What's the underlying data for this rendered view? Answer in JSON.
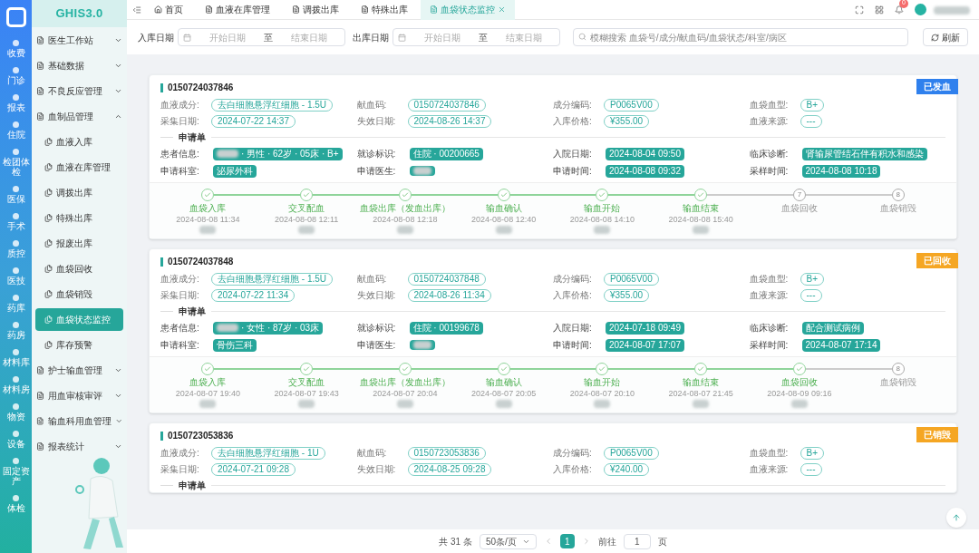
{
  "logo": "GHIS3.0",
  "rail": [
    {
      "label": "收费",
      "selected": false
    },
    {
      "label": "门诊",
      "selected": false
    },
    {
      "label": "报表",
      "selected": false
    },
    {
      "label": "住院",
      "selected": false
    },
    {
      "label": "检团体检",
      "selected": false
    },
    {
      "label": "医保",
      "selected": false
    },
    {
      "label": "手术",
      "selected": false
    },
    {
      "label": "质控",
      "selected": false
    },
    {
      "label": "医技",
      "selected": false
    },
    {
      "label": "药库",
      "selected": false
    },
    {
      "label": "药房",
      "selected": false
    },
    {
      "label": "材料库",
      "selected": false
    },
    {
      "label": "材料房",
      "selected": false
    },
    {
      "label": "物资",
      "selected": false
    },
    {
      "label": "设备",
      "selected": false
    },
    {
      "label": "固定资产",
      "selected": false
    },
    {
      "label": "体检",
      "selected": false
    }
  ],
  "menu": [
    {
      "label": "医生工作站",
      "expanded": false
    },
    {
      "label": "基础数据",
      "expanded": false
    },
    {
      "label": "不良反应管理",
      "expanded": false
    },
    {
      "label": "血制品管理",
      "expanded": true,
      "children": [
        {
          "label": "血液入库",
          "selected": false
        },
        {
          "label": "血液在库管理",
          "selected": false
        },
        {
          "label": "调拨出库",
          "selected": false
        },
        {
          "label": "特殊出库",
          "selected": false
        },
        {
          "label": "报废出库",
          "selected": false
        },
        {
          "label": "血袋回收",
          "selected": false
        },
        {
          "label": "血袋销毁",
          "selected": false
        },
        {
          "label": "血袋状态监控",
          "selected": true
        },
        {
          "label": "库存预警",
          "selected": false
        }
      ]
    },
    {
      "label": "护士输血管理",
      "expanded": false
    },
    {
      "label": "用血审核审评",
      "expanded": false
    },
    {
      "label": "输血科用血管理",
      "expanded": false
    },
    {
      "label": "报表统计",
      "expanded": false
    }
  ],
  "tabs": [
    {
      "label": "首页",
      "selected": false
    },
    {
      "label": "血液在库管理",
      "selected": false
    },
    {
      "label": "调拨出库",
      "selected": false
    },
    {
      "label": "特殊出库",
      "selected": false
    },
    {
      "label": "血袋状态监控",
      "selected": true,
      "closable": true
    }
  ],
  "notifications": "0",
  "filters": [
    {
      "label": "入库日期",
      "start": "开始日期",
      "sep": "至",
      "end": "结束日期"
    },
    {
      "label": "出库日期",
      "start": "开始日期",
      "sep": "至",
      "end": "结束日期"
    }
  ],
  "search": {
    "placeholder": "模糊搜索 血袋号/成分/献血码/血袋状态/科室/病区"
  },
  "refresh": "刷新",
  "cards": [
    {
      "id": "0150724037846",
      "status": {
        "label": "已发血",
        "color": "#2f80ed"
      },
      "fields": [
        {
          "label": "血液成分:",
          "value": "去白细胞悬浮红细胞 - 1.5U"
        },
        {
          "label": "献血码:",
          "value": "0150724037846"
        },
        {
          "label": "成分编码:",
          "value": "P0065V00"
        },
        {
          "label": "血袋血型:",
          "value": "B+"
        },
        {
          "label": "采集日期:",
          "value": "2024-07-22 14:37"
        },
        {
          "label": "失效日期:",
          "value": "2024-08-26 14:37"
        },
        {
          "label": "入库价格:",
          "value": "¥355.00"
        },
        {
          "label": "血液来源:",
          "value": "---"
        }
      ],
      "application": {
        "title": "申请单",
        "fields": [
          {
            "label": "患者信息:",
            "value": "· 男性 · 62岁 · 05床 · B+",
            "redacted": true
          },
          {
            "label": "就诊标识:",
            "value": "住院 · 00200665",
            "redacted": false
          },
          {
            "label": "入院日期:",
            "value": "2024-08-04 09:50",
            "redacted": false
          },
          {
            "label": "临床诊断:",
            "value": "肾输尿管结石伴有积水和感染",
            "redacted": false
          },
          {
            "label": "申请科室:",
            "value": "泌尿外科",
            "redacted": false
          },
          {
            "label": "申请医生:",
            "redacted": true
          },
          {
            "label": "申请时间:",
            "value": "2024-08-08 09:32",
            "redacted": false
          },
          {
            "label": "采样时间:",
            "value": "2024-08-08 10:18",
            "redacted": false
          }
        ]
      },
      "steps": [
        {
          "label": "血袋入库",
          "done": true,
          "time": "2024-08-08 11:34"
        },
        {
          "label": "交叉配血",
          "done": true,
          "time": "2024-08-08 12:11"
        },
        {
          "label": "血袋出库（发血出库）",
          "done": true,
          "time": "2024-08-08 12:18"
        },
        {
          "label": "输血确认",
          "done": true,
          "time": "2024-08-08 12:40"
        },
        {
          "label": "输血开始",
          "done": true,
          "time": "2024-08-08 14:10"
        },
        {
          "label": "输血结束",
          "done": true,
          "time": "2024-08-08 15:40"
        },
        {
          "label": "血袋回收",
          "done": false,
          "number": "7"
        },
        {
          "label": "血袋销毁",
          "done": false,
          "number": "8"
        }
      ]
    },
    {
      "id": "0150724037848",
      "status": {
        "label": "已回收",
        "color": "#f5a623"
      },
      "fields": [
        {
          "label": "血液成分:",
          "value": "去白细胞悬浮红细胞 - 1.5U"
        },
        {
          "label": "献血码:",
          "value": "0150724037848"
        },
        {
          "label": "成分编码:",
          "value": "P0065V00"
        },
        {
          "label": "血袋血型:",
          "value": "B+"
        },
        {
          "label": "采集日期:",
          "value": "2024-07-22 11:34"
        },
        {
          "label": "失效日期:",
          "value": "2024-08-26 11:34"
        },
        {
          "label": "入库价格:",
          "value": "¥355.00"
        },
        {
          "label": "血液来源:",
          "value": "---"
        }
      ],
      "application": {
        "title": "申请单",
        "fields": [
          {
            "label": "患者信息:",
            "value": "· 女性 · 87岁 · 03床",
            "redacted": true
          },
          {
            "label": "就诊标识:",
            "value": "住院 · 00199678",
            "redacted": false
          },
          {
            "label": "入院日期:",
            "value": "2024-07-18 09:49",
            "redacted": false
          },
          {
            "label": "临床诊断:",
            "value": "配合测试病例",
            "redacted": false
          },
          {
            "label": "申请科室:",
            "value": "骨伤三科",
            "redacted": false
          },
          {
            "label": "申请医生:",
            "redacted": true
          },
          {
            "label": "申请时间:",
            "value": "2024-08-07 17:07",
            "redacted": false
          },
          {
            "label": "采样时间:",
            "value": "2024-08-07 17:14",
            "redacted": false
          }
        ]
      },
      "steps": [
        {
          "label": "血袋入库",
          "done": true,
          "time": "2024-08-07 19:40"
        },
        {
          "label": "交叉配血",
          "done": true,
          "time": "2024-08-07 19:43"
        },
        {
          "label": "血袋出库（发血出库）",
          "done": true,
          "time": "2024-08-07 20:04"
        },
        {
          "label": "输血确认",
          "done": true,
          "time": "2024-08-07 20:05"
        },
        {
          "label": "输血开始",
          "done": true,
          "time": "2024-08-07 20:10"
        },
        {
          "label": "输血结束",
          "done": true,
          "time": "2024-08-07 21:45"
        },
        {
          "label": "血袋回收",
          "done": true,
          "time": "2024-08-09 09:16"
        },
        {
          "label": "血袋销毁",
          "done": false,
          "number": "8"
        }
      ]
    },
    {
      "id": "0150723053836",
      "status": {
        "label": "已销毁",
        "color": "#f5a623"
      },
      "fields": [
        {
          "label": "血液成分:",
          "value": "去白细胞悬浮红细胞 - 1U"
        },
        {
          "label": "献血码:",
          "value": "0150723053836"
        },
        {
          "label": "成分编码:",
          "value": "P0065V00"
        },
        {
          "label": "血袋血型:",
          "value": "B+"
        },
        {
          "label": "采集日期:",
          "value": "2024-07-21 09:28"
        },
        {
          "label": "失效日期:",
          "value": "2024-08-25 09:28"
        },
        {
          "label": "入库价格:",
          "value": "¥240.00"
        },
        {
          "label": "血液来源:",
          "value": "---"
        }
      ],
      "application": {
        "title": "申请单"
      }
    }
  ],
  "pagination": {
    "total": "共 31 条",
    "page_size": "50条/页",
    "pages": [
      {
        "label": "1",
        "selected": true
      }
    ],
    "goto": "前往",
    "goto_value": "1",
    "goto_unit": "页"
  }
}
